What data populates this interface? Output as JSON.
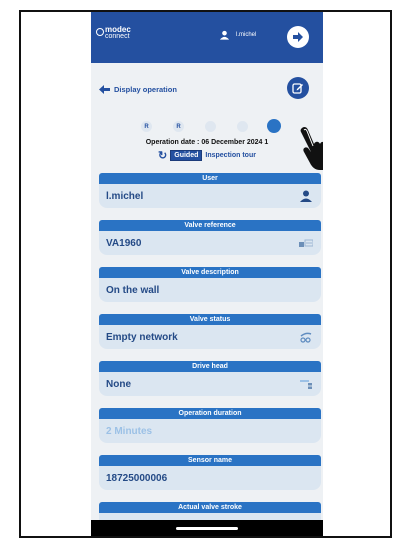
{
  "header": {
    "logo_primary": "modec",
    "logo_secondary": "connect",
    "user_name": "l.michel",
    "logout_icon": "logout-icon"
  },
  "nav": {
    "back_label": "Display operation",
    "edit_icon": "edit-icon"
  },
  "steps": [
    {
      "label": "R"
    },
    {
      "label": "R"
    },
    {
      "label": ""
    },
    {
      "label": ""
    },
    {
      "label": ""
    }
  ],
  "operation": {
    "date_text": "Operation date : 06 December 2024 1",
    "mode_active": "Guided",
    "mode_other": "Inspection tour"
  },
  "fields": [
    {
      "title": "User",
      "value": "l.michel",
      "icon": "person-icon"
    },
    {
      "title": "Valve reference",
      "value": "VA1960",
      "icon": "valve-reference-icon"
    },
    {
      "title": "Valve description",
      "value": "On the wall",
      "icon": ""
    },
    {
      "title": "Valve status",
      "value": "Empty network",
      "icon": "valve-status-icon"
    },
    {
      "title": "Drive head",
      "value": "None",
      "icon": "drive-head-icon"
    },
    {
      "title": "Operation duration",
      "value": "2",
      "value_suffix": "Minutes",
      "icon": ""
    },
    {
      "title": "Sensor name",
      "value": "18725000006",
      "icon": ""
    },
    {
      "title": "Actual valve stroke",
      "value": "",
      "icon": ""
    }
  ],
  "colors": {
    "brand_blue": "#2450a0",
    "card_header": "#2a73c4",
    "card_body": "#dbe6f1"
  }
}
